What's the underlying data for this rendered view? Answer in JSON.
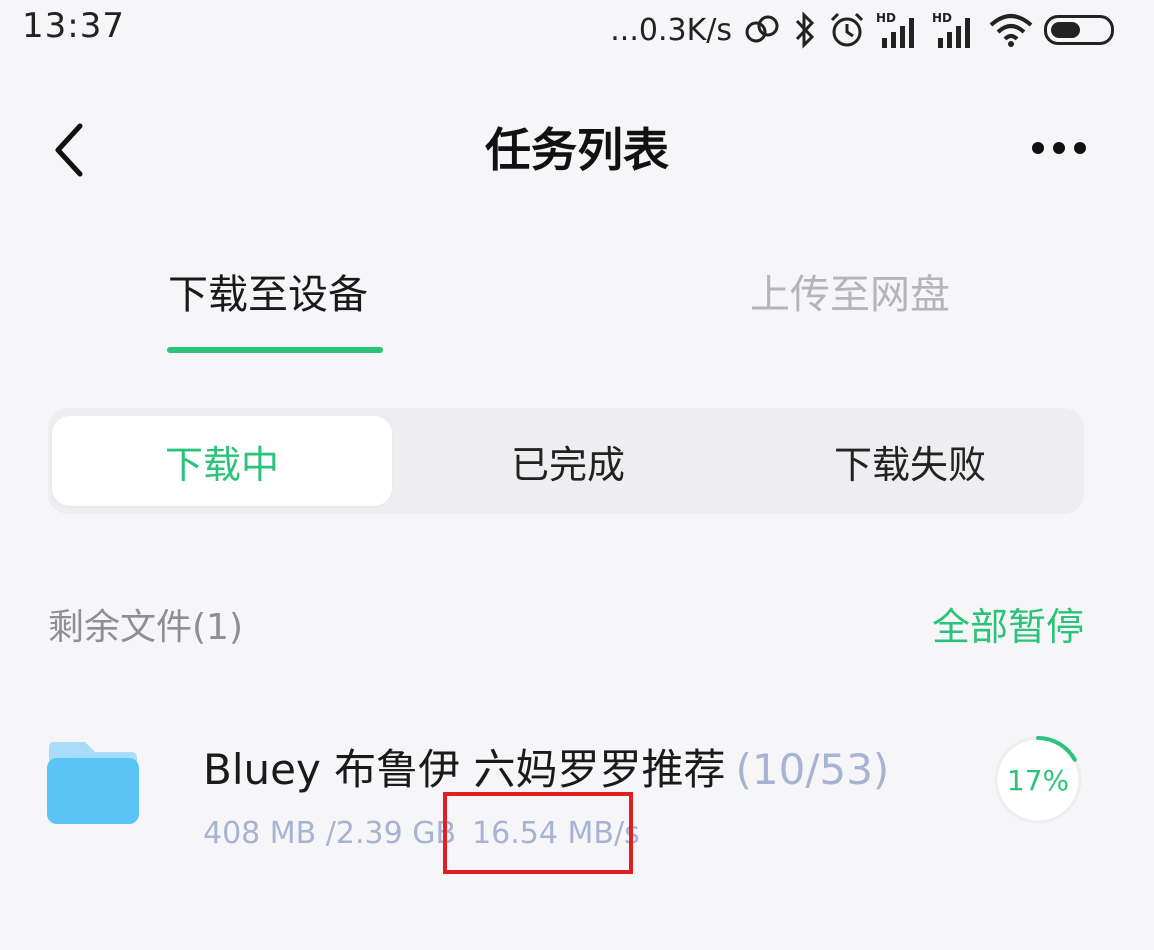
{
  "status_bar": {
    "time": "13:37",
    "network_speed": "...0.3K/s",
    "icons": [
      "link-icon",
      "bluetooth-icon",
      "alarm-icon",
      "signal-hd-icon",
      "signal-hd-icon",
      "wifi-icon",
      "battery-icon"
    ],
    "battery_level": 0.52
  },
  "header": {
    "title": "任务列表",
    "back_icon": "chevron-left-icon",
    "more_icon": "more-horizontal-icon"
  },
  "tabs": [
    {
      "label": "下载至设备",
      "active": true
    },
    {
      "label": "上传至网盘",
      "active": false
    }
  ],
  "segments": [
    {
      "label": "下载中",
      "active": true
    },
    {
      "label": "已完成",
      "active": false
    },
    {
      "label": "下载失败",
      "active": false
    }
  ],
  "section": {
    "remaining_label": "剩余文件(1)",
    "pause_all_label": "全部暂停"
  },
  "tasks": [
    {
      "name": "Bluey 布鲁伊 六妈罗罗推荐",
      "count": "(10/53)",
      "progress_size": "408 MB /2.39 GB",
      "speed": "16.54 MB/s",
      "percent_text": "17%",
      "percent": 0.17,
      "icon": "folder-icon"
    }
  ],
  "colors": {
    "accent": "#2bc37a",
    "muted_text": "#a7b3d3",
    "highlight": "#e02020",
    "folder": "#5bc4f7"
  }
}
